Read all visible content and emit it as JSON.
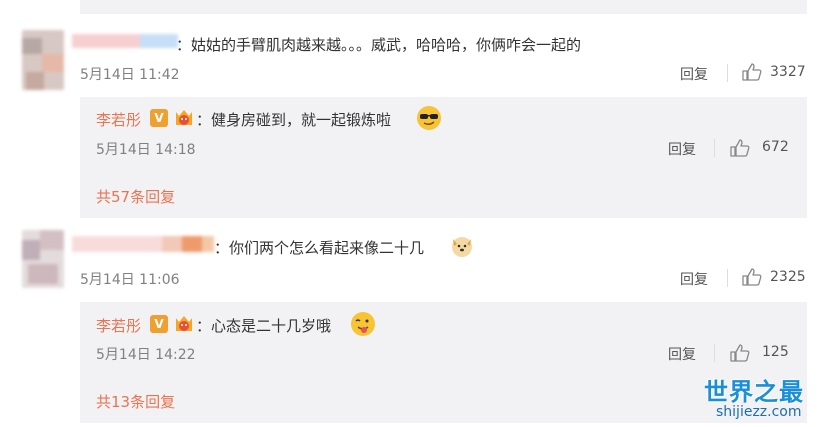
{
  "comments": [
    {
      "text": "：姑姑的手臂肌肉越来越。。。威武，哈哈哈，你俩咋会一起的",
      "time": "5月14日 11:42",
      "reply_label": "回复",
      "likes": "3327",
      "replies": [
        {
          "author": "李若彤",
          "text": "：健身房碰到，就一起锻炼啦",
          "time": "5月14日 14:18",
          "reply_label": "回复",
          "likes": "672",
          "emoji": "sunglasses-emoji"
        }
      ],
      "more_replies": "共57条回复"
    },
    {
      "text": "：你们两个怎么看起来像二十几",
      "time": "5月14日 11:06",
      "reply_label": "回复",
      "likes": "2325",
      "emoji": "dog-emoji",
      "replies": [
        {
          "author": "李若彤",
          "text": "：心态是二十几岁哦",
          "time": "5月14日 14:22",
          "reply_label": "回复",
          "likes": "125",
          "emoji": "tongue-emoji"
        }
      ],
      "more_replies": "共13条回复"
    }
  ],
  "watermark": {
    "title": "世界之最",
    "url": "shijiezz.com"
  },
  "colors": {
    "link": "#eb7350",
    "reply_bg": "#f2f2f5",
    "watermark": "#1a8fd6"
  },
  "badge": {
    "verified": "V"
  }
}
